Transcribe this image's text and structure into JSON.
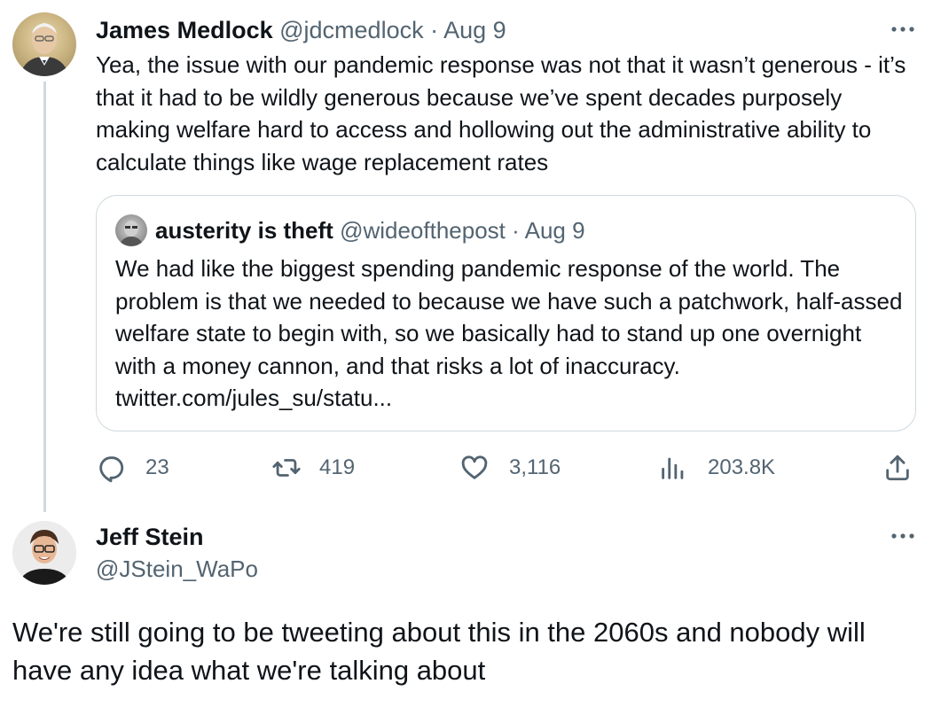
{
  "tweet": {
    "author_name": "James Medlock",
    "handle": "@jdcmedlock",
    "separator": "·",
    "date": "Aug 9",
    "text": "Yea, the issue with our pandemic response was not that it wasn’t generous - it’s that it had to be wildly generous because we’ve spent decades purposely making welfare hard to access and hollowing out the administrative ability to calculate things like wage replacement rates",
    "quoted": {
      "author_name": "austerity is theft",
      "handle": "@wideofthepost",
      "separator": "·",
      "date": "Aug 9",
      "text": "We had like the biggest spending pandemic response of the world. The problem is that we needed to because we have such a patchwork, half-assed welfare state to begin with, so we basically had to stand up one overnight with a money cannon, and that risks a lot of inaccuracy.",
      "link": "twitter.com/jules_su/statu..."
    },
    "actions": {
      "replies": "23",
      "retweets": "419",
      "likes": "3,116",
      "views": "203.8K"
    }
  },
  "reply": {
    "author_name": "Jeff Stein",
    "handle": "@JStein_WaPo",
    "text": "We're still going to be tweeting about this in the 2060s and nobody will have any idea what we're talking about"
  },
  "icons": {
    "reply": "speech-bubble-icon",
    "retweet": "retweet-arrows-icon",
    "like": "heart-icon",
    "views": "bar-chart-icon",
    "share": "share-upload-icon",
    "more": "more-dots-icon"
  },
  "colors": {
    "text": "#0f1419",
    "muted": "#536471",
    "border": "#cfd9de"
  }
}
